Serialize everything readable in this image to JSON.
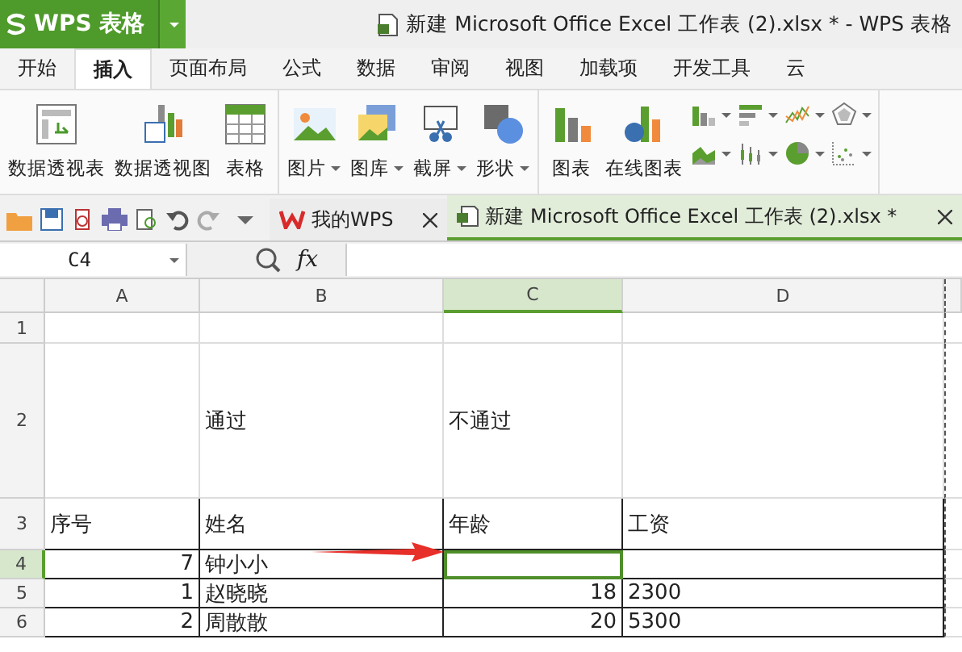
{
  "app_button": {
    "label": "WPS 表格"
  },
  "window": {
    "title": "新建 Microsoft Office Excel 工作表 (2).xlsx * - WPS 表格"
  },
  "tabs": [
    {
      "label": "开始",
      "selected": false
    },
    {
      "label": "插入",
      "selected": true
    },
    {
      "label": "页面布局",
      "selected": false
    },
    {
      "label": "公式",
      "selected": false
    },
    {
      "label": "数据",
      "selected": false
    },
    {
      "label": "审阅",
      "selected": false
    },
    {
      "label": "视图",
      "selected": false
    },
    {
      "label": "加载项",
      "selected": false
    },
    {
      "label": "开发工具",
      "selected": false
    },
    {
      "label": "云",
      "selected": false
    }
  ],
  "ribbon_groups": [
    {
      "buttons": [
        {
          "kind": "pivot-table",
          "label": "数据透视表",
          "dropdown": false
        },
        {
          "kind": "pivot-chart",
          "label": "数据透视图",
          "dropdown": false
        },
        {
          "kind": "table",
          "label": "表格",
          "dropdown": false
        }
      ]
    },
    {
      "buttons": [
        {
          "kind": "picture",
          "label": "图片",
          "dropdown": true
        },
        {
          "kind": "gallery",
          "label": "图库",
          "dropdown": true
        },
        {
          "kind": "screenshot",
          "label": "截屏",
          "dropdown": true
        },
        {
          "kind": "shapes",
          "label": "形状",
          "dropdown": true
        }
      ]
    },
    {
      "buttons": [
        {
          "kind": "chart",
          "label": "图表",
          "dropdown": false
        },
        {
          "kind": "online-chart",
          "label": "在线图表",
          "dropdown": false
        }
      ],
      "small_buttons": [
        {
          "kind": "column"
        },
        {
          "kind": "bar"
        },
        {
          "kind": "line"
        },
        {
          "kind": "radar"
        },
        {
          "kind": "area"
        },
        {
          "kind": "stock"
        },
        {
          "kind": "pie"
        },
        {
          "kind": "scatter"
        }
      ]
    }
  ],
  "doc_tabs": [
    {
      "label": "我的WPS",
      "selected": false
    },
    {
      "label": "新建 Microsoft Office Excel 工作表 (2).xlsx *",
      "selected": true
    }
  ],
  "formula_bar": {
    "cell_ref": "C4",
    "function_label": "fx"
  },
  "sheet": {
    "columns": [
      {
        "label": "A",
        "selected": false
      },
      {
        "label": "B",
        "selected": false
      },
      {
        "label": "C",
        "selected": true
      },
      {
        "label": "D",
        "selected": false
      }
    ],
    "rows": [
      {
        "header": "1",
        "selected": false,
        "bordered": false,
        "cells": [
          {
            "kind": "text",
            "active": false
          },
          {
            "kind": "text",
            "active": false
          },
          {
            "kind": "text",
            "active": false
          },
          {
            "kind": "text",
            "active": false
          }
        ]
      },
      {
        "header": "2",
        "selected": false,
        "bordered": false,
        "cells": [
          {
            "kind": "text",
            "active": false
          },
          {
            "kind": "text",
            "text": "通过",
            "active": false
          },
          {
            "kind": "text",
            "text": "不通过",
            "active": false
          },
          {
            "kind": "text",
            "active": false
          }
        ]
      },
      {
        "header": "3",
        "selected": false,
        "bordered": true,
        "cells": [
          {
            "kind": "text",
            "text": "序号",
            "active": false
          },
          {
            "kind": "text",
            "text": "姓名",
            "active": false
          },
          {
            "kind": "text",
            "text": "年龄",
            "active": false
          },
          {
            "kind": "text",
            "text": "工资",
            "active": false
          }
        ]
      },
      {
        "header": "4",
        "selected": true,
        "bordered": true,
        "cells": [
          {
            "kind": "number",
            "text": "7",
            "active": false
          },
          {
            "kind": "text",
            "text": "钟小小",
            "active": false
          },
          {
            "kind": "text",
            "active": true
          },
          {
            "kind": "text",
            "active": false
          }
        ]
      },
      {
        "header": "5",
        "selected": false,
        "bordered": true,
        "cells": [
          {
            "kind": "number",
            "text": "1",
            "active": false
          },
          {
            "kind": "text",
            "text": "赵晓晓",
            "active": false
          },
          {
            "kind": "number",
            "text": "18",
            "active": false
          },
          {
            "kind": "text",
            "text": "2300",
            "active": false
          }
        ]
      },
      {
        "header": "6",
        "selected": false,
        "bordered": true,
        "cells": [
          {
            "kind": "number",
            "text": "2",
            "active": false
          },
          {
            "kind": "text",
            "text": "周散散",
            "active": false
          },
          {
            "kind": "number",
            "text": "20",
            "active": false
          },
          {
            "kind": "text",
            "text": "5300",
            "active": false
          }
        ]
      }
    ]
  }
}
